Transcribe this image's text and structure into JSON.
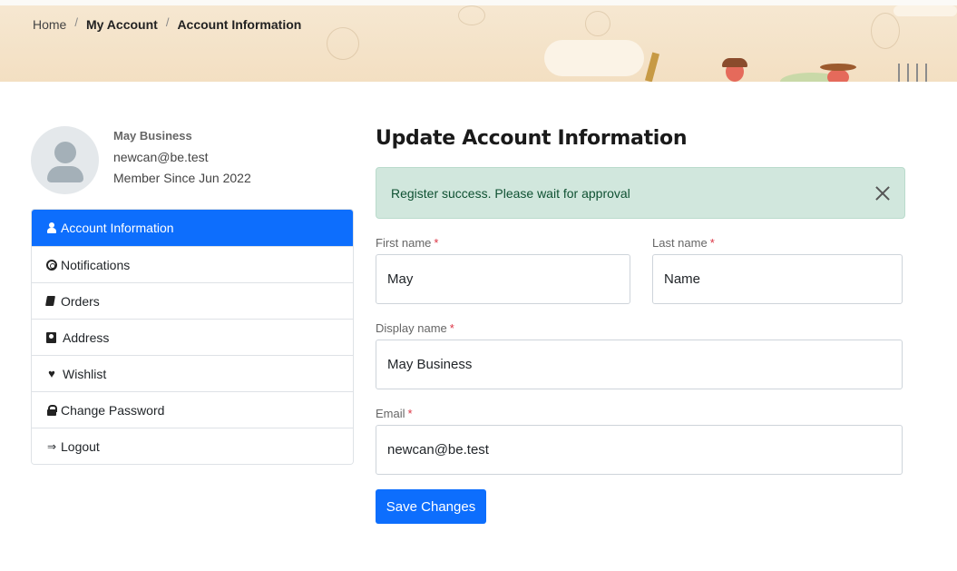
{
  "breadcrumb": {
    "items": [
      "Home",
      "My Account",
      "Account Information"
    ],
    "separator": "/"
  },
  "profile": {
    "name": "May Business",
    "email": "newcan@be.test",
    "member_since": "Member Since Jun 2022"
  },
  "sidebar": {
    "items": [
      {
        "label": "Account Information",
        "icon": "user-icon",
        "active": true
      },
      {
        "label": "Notifications",
        "icon": "life-ring-icon",
        "active": false
      },
      {
        "label": "Orders",
        "icon": "book-icon",
        "active": false
      },
      {
        "label": "Address",
        "icon": "address-book-icon",
        "active": false
      },
      {
        "label": "Wishlist",
        "icon": "heart-icon",
        "active": false
      },
      {
        "label": "Change Password",
        "icon": "lock-icon",
        "active": false
      },
      {
        "label": "Logout",
        "icon": "logout-icon",
        "active": false
      }
    ]
  },
  "main": {
    "title": "Update Account Information",
    "alert": {
      "message": "Register success. Please wait for approval"
    },
    "form": {
      "first_name": {
        "label": "First name",
        "required_mark": "*",
        "value": "May"
      },
      "last_name": {
        "label": "Last name",
        "required_mark": "*",
        "value": "Name"
      },
      "display_name": {
        "label": "Display name",
        "required_mark": "*",
        "value": "May Business"
      },
      "email": {
        "label": "Email",
        "required_mark": "*",
        "value": "newcan@be.test"
      },
      "save_label": "Save Changes"
    }
  },
  "colors": {
    "primary": "#0d6efd",
    "alert_bg": "#d1e7dd",
    "alert_text": "#0f5132",
    "required": "#dc3545",
    "banner_bg": "#f3dfc2"
  }
}
